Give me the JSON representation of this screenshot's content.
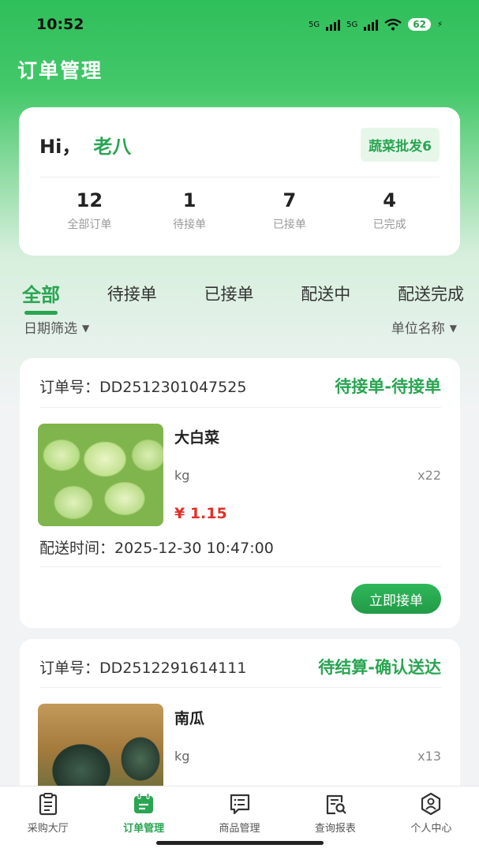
{
  "status_bar": {
    "time": "10:52",
    "network1": "5G",
    "network2": "5G",
    "battery": "62"
  },
  "page": {
    "title": "订单管理"
  },
  "user": {
    "hi": "Hi，",
    "name": "老八",
    "store": "蔬菜批发6"
  },
  "stats": [
    {
      "value": "12",
      "label": "全部订单"
    },
    {
      "value": "1",
      "label": "待接单"
    },
    {
      "value": "7",
      "label": "已接单"
    },
    {
      "value": "4",
      "label": "已完成"
    }
  ],
  "tabs": [
    "全部",
    "待接单",
    "已接单",
    "配送中",
    "配送完成"
  ],
  "filters": {
    "date": "日期筛选",
    "unit": "单位名称"
  },
  "orders": [
    {
      "order_no": "订单号：DD2512301047525",
      "status": "待接单-待接单",
      "product": {
        "name": "大白菜",
        "unit": "kg",
        "qty": "x22",
        "price": "¥ 1.15"
      },
      "delivery": "配送时间：2025-12-30 10:47:00",
      "action": "立即接单"
    },
    {
      "order_no": "订单号：DD2512291614111",
      "status": "待结算-确认送达",
      "product": {
        "name": "南瓜",
        "unit": "kg",
        "qty": "x13"
      }
    }
  ],
  "tabbar": [
    {
      "label": "采购大厅",
      "icon": "clipboard-icon"
    },
    {
      "label": "订单管理",
      "icon": "order-calendar-icon"
    },
    {
      "label": "商品管理",
      "icon": "goods-list-icon"
    },
    {
      "label": "查询报表",
      "icon": "report-search-icon"
    },
    {
      "label": "个人中心",
      "icon": "user-icon"
    }
  ],
  "colors": {
    "accent": "#2aa552",
    "price": "#e0302a"
  }
}
